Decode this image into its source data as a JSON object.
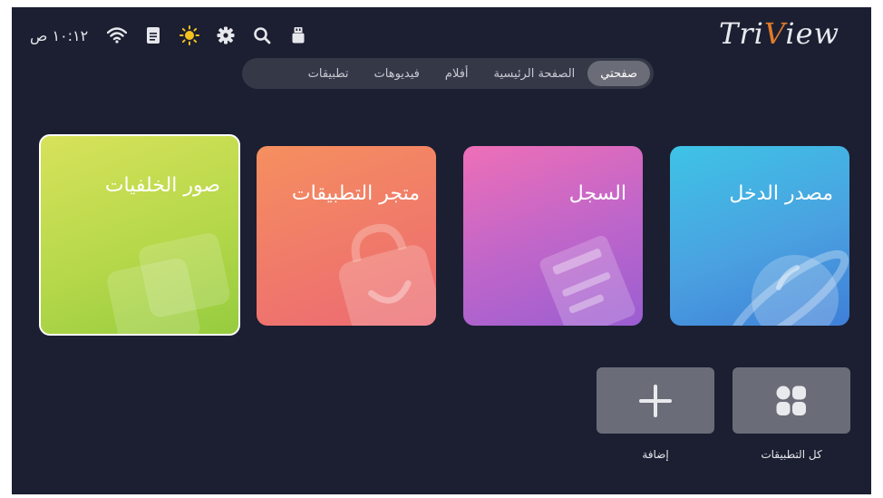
{
  "status": {
    "time": "١٠:١٢ ص",
    "icons": [
      "wifi-icon",
      "document-icon",
      "brightness-icon",
      "gear-icon",
      "search-icon",
      "usb-icon"
    ]
  },
  "logo": {
    "prefix": "Tri",
    "v": "V",
    "suffix": "iew"
  },
  "tabs": [
    {
      "label": "صفحتي",
      "active": true
    },
    {
      "label": "الصفحة الرئيسية",
      "active": false
    },
    {
      "label": "أفلام",
      "active": false
    },
    {
      "label": "فيديوهات",
      "active": false
    },
    {
      "label": "تطبيقات",
      "active": false
    }
  ],
  "cards": {
    "input": {
      "title": "مصدر الدخل",
      "icon": "planet-icon"
    },
    "history": {
      "title": "السجل",
      "icon": "history-book-icon"
    },
    "store": {
      "title": "متجر التطبيقات",
      "icon": "shopping-bag-icon"
    },
    "wallpaper": {
      "title": "صور الخلفيات",
      "icon": "wallpaper-icon"
    }
  },
  "tiles": {
    "all_apps": {
      "label": "كل التطبيقات",
      "icon": "grid-icon"
    },
    "add": {
      "label": "إضافة",
      "icon": "plus-icon"
    }
  }
}
